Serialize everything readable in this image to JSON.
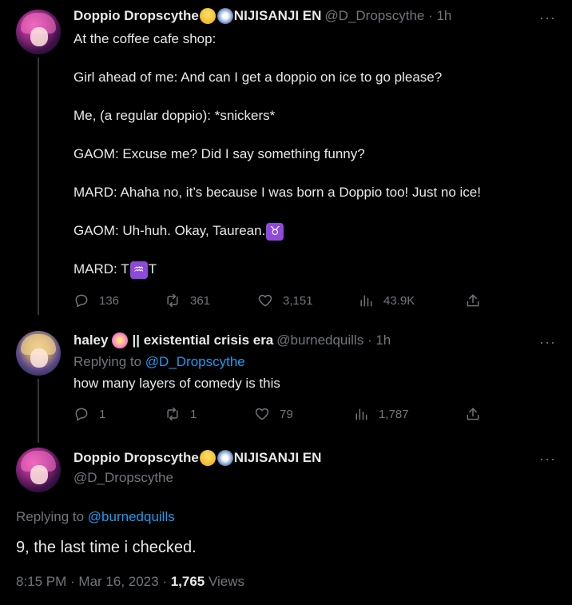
{
  "tweet1": {
    "name": "Doppio Dropscythe",
    "badge": "NIJISANJI EN",
    "handle": "@D_Dropscythe",
    "time": "1h",
    "lines": [
      "At the coffee cafe shop:",
      "",
      "Girl ahead of me: And can I get a doppio on ice to go please?",
      "",
      "Me, (a regular doppio): *snickers*",
      "",
      "GAOM: Excuse me? Did I say something funny?",
      "",
      "MARD: Ahaha no, it’s because I was born a Doppio too! Just no ice!",
      "",
      "GAOM: Uh-huh. Okay, Taurean.",
      "",
      "MARD: T"
    ],
    "taurus_glyph": "♉",
    "aquarius_glyph": "♒",
    "mard_tail": "T",
    "replies": "136",
    "retweets": "361",
    "likes": "3,151",
    "views": "43.9K"
  },
  "tweet2": {
    "name": "haley",
    "name_suffix": "|| existential crisis era",
    "handle": "@burnedquills",
    "time": "1h",
    "replying_label": "Replying to",
    "replying_to": "@D_Dropscythe",
    "text": "how many layers of comedy is this",
    "replies": "1",
    "retweets": "1",
    "likes": "79",
    "views": "1,787"
  },
  "tweet3": {
    "name": "Doppio Dropscythe",
    "badge": "NIJISANJI EN",
    "handle": "@D_Dropscythe",
    "replying_label": "Replying to",
    "replying_to": "@burnedquills",
    "text": "9, the last time i checked.",
    "timestamp": "8:15 PM · Mar 16, 2023 ·",
    "views_count": "1,765",
    "views_label": "Views"
  },
  "icons": {
    "more": "···"
  },
  "colors": {
    "background": "#000000",
    "text": "#e7e9ea",
    "muted": "#71767b",
    "link": "#1d9bf0"
  }
}
